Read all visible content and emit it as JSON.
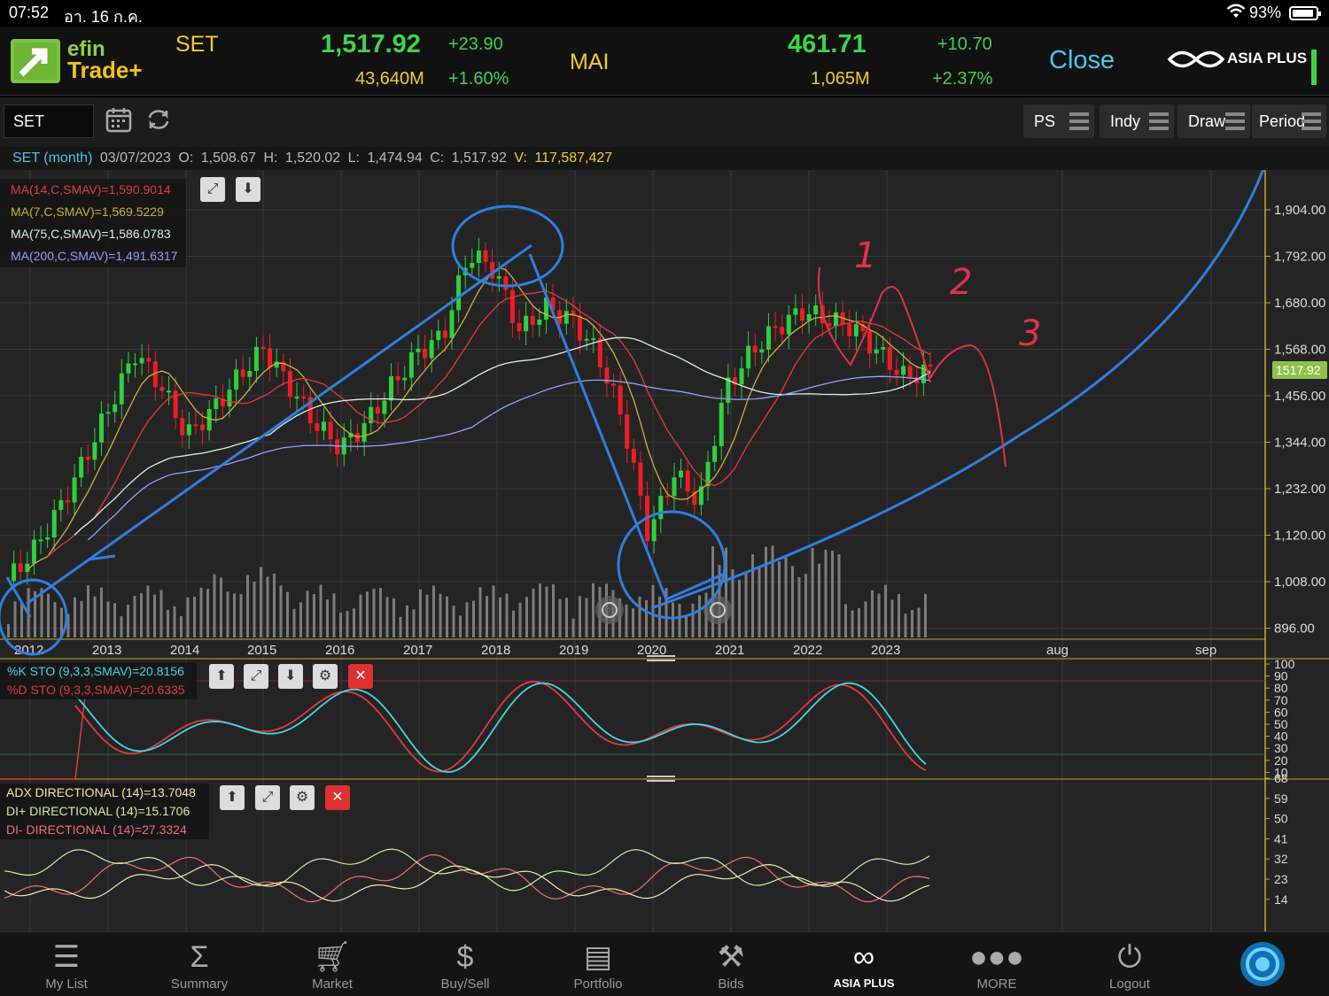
{
  "status_bar": {
    "time": "07:52",
    "date": "อา. 16 ก.ค.",
    "battery": "93%"
  },
  "brand": {
    "line1": "efin",
    "line2": "Trade+"
  },
  "ticker": {
    "set": {
      "name": "SET",
      "value": "1,517.92",
      "change": "+23.90",
      "volume": "43,640M",
      "percent": "+1.60%"
    },
    "mai": {
      "name": "MAI",
      "value": "461.71",
      "change": "+10.70",
      "volume": "1,065M",
      "percent": "+2.37%"
    },
    "market_status": "Close",
    "broker": "ASIA PLUS"
  },
  "toolbar": {
    "symbol": "SET",
    "buttons": [
      "PS",
      "Indy",
      "Draw",
      "Period"
    ]
  },
  "info_line": {
    "symbol": "SET (month)",
    "date": "03/07/2023",
    "o_label": "O:",
    "o": "1,508.67",
    "h_label": "H:",
    "h": "1,520.02",
    "l_label": "L:",
    "l": "1,474.94",
    "c_label": "C:",
    "c": "1,517.92",
    "v_label": "V:",
    "v": "117,587,427"
  },
  "ma_legend": [
    {
      "text": "MA(14,C,SMAV)=1,590.9014",
      "color": "#e33b3b"
    },
    {
      "text": "MA(7,C,SMAV)=1,569.5229",
      "color": "#c9b43a"
    },
    {
      "text": "MA(75,C,SMAV)=1,586.0783",
      "color": "#d8f0e8"
    },
    {
      "text": "MA(200,C,SMAV)=1,491.6317",
      "color": "#8fa2ff"
    }
  ],
  "sto_legend": [
    {
      "text": "%K STO (9,3,3,SMAV)=20.8156",
      "color": "#42d7e8"
    },
    {
      "text": "%D STO (9,3,3,SMAV)=20.6335",
      "color": "#e33b3b"
    }
  ],
  "adx_legend": [
    {
      "text": "ADX DIRECTIONAL (14)=13.7048",
      "color": "#f1e6b0"
    },
    {
      "text": "DI+ DIRECTIONAL (14)=15.1706",
      "color": "#c9f0a8"
    },
    {
      "text": "DI- DIRECTIONAL (14)=27.3324",
      "color": "#f07070"
    }
  ],
  "chart_data": {
    "type": "candlestick",
    "interval": "month",
    "price_axis": [
      "1,904.00",
      "1,792.00",
      "1,680.00",
      "1,568.00",
      "1,456.00",
      "1,344.00",
      "1,232.00",
      "1,120.00",
      "1,008.00",
      "896.00"
    ],
    "last_price_tag": "1517.92",
    "x_labels": [
      "2012",
      "2013",
      "2014",
      "2015",
      "2016",
      "2017",
      "2018",
      "2019",
      "2020",
      "2021",
      "2022",
      "2023",
      "aug",
      "sep"
    ],
    "close_path": [
      1010,
      1080,
      1180,
      1300,
      1430,
      1560,
      1480,
      1360,
      1420,
      1500,
      1570,
      1480,
      1390,
      1330,
      1390,
      1480,
      1560,
      1600,
      1800,
      1760,
      1610,
      1670,
      1640,
      1560,
      1400,
      1120,
      1270,
      1200,
      1470,
      1560,
      1620,
      1660,
      1640,
      1620,
      1560,
      1500,
      1517.92
    ],
    "sto_axis": [
      "100",
      "90",
      "80",
      "70",
      "60",
      "50",
      "40",
      "30",
      "20",
      "10"
    ],
    "adx_axis": [
      "68",
      "59",
      "50",
      "41",
      "32",
      "23",
      "14"
    ],
    "annotations": [
      "1",
      "2",
      "3"
    ]
  },
  "nav": [
    {
      "label": "My List",
      "icon": "list-icon"
    },
    {
      "label": "Summary",
      "icon": "sigma-icon"
    },
    {
      "label": "Market",
      "icon": "cart-icon"
    },
    {
      "label": "Buy/Sell",
      "icon": "dollar-icon"
    },
    {
      "label": "Portfolio",
      "icon": "document-icon"
    },
    {
      "label": "Bids",
      "icon": "gavel-icon"
    },
    {
      "label": "ASIA PLUS",
      "icon": "asiaplus-logo-icon"
    },
    {
      "label": "MORE",
      "icon": "more-dots-icon"
    },
    {
      "label": "Logout",
      "icon": "power-icon"
    }
  ]
}
